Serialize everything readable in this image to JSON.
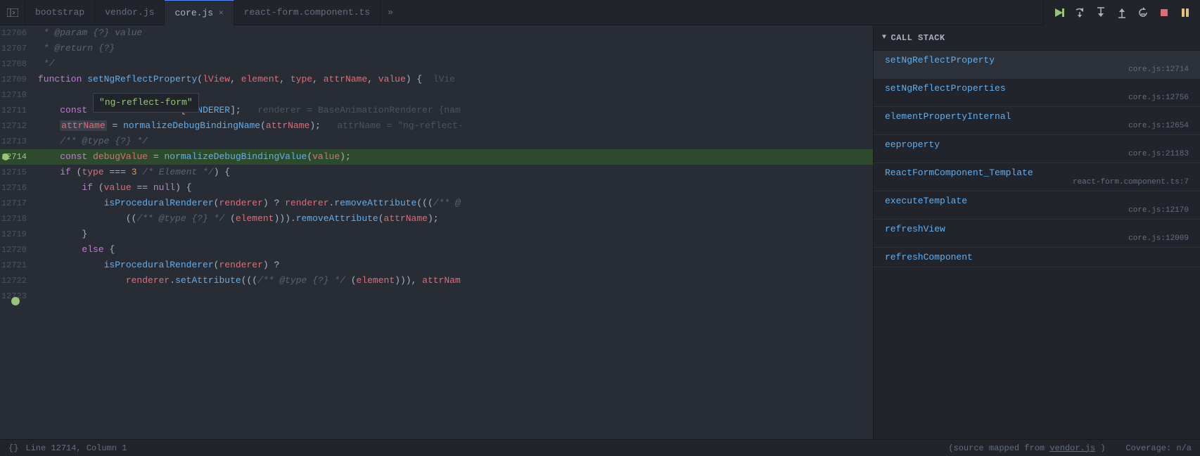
{
  "tabs": [
    {
      "id": "bootstrap",
      "label": "bootstrap",
      "active": false,
      "closable": false
    },
    {
      "id": "vendor",
      "label": "vendor.js",
      "active": false,
      "closable": false
    },
    {
      "id": "core",
      "label": "core.js",
      "active": true,
      "closable": true
    },
    {
      "id": "react-form",
      "label": "react-form.component.ts",
      "active": false,
      "closable": false
    }
  ],
  "tab_overflow_label": "»",
  "debug_buttons": [
    {
      "id": "continue",
      "icon": "▶",
      "class": "green",
      "label": "Continue"
    },
    {
      "id": "step-over",
      "icon": "↷",
      "class": "",
      "label": "Step Over"
    },
    {
      "id": "step-into",
      "icon": "↓",
      "class": "",
      "label": "Step Into"
    },
    {
      "id": "step-out",
      "icon": "↑",
      "class": "",
      "label": "Step Out"
    },
    {
      "id": "restart",
      "icon": "⟳",
      "class": "",
      "label": "Restart"
    },
    {
      "id": "stop",
      "icon": "⏹",
      "class": "",
      "label": "Stop"
    },
    {
      "id": "pause",
      "icon": "⏸",
      "class": "pause",
      "label": "Pause"
    }
  ],
  "code_lines": [
    {
      "num": "12706",
      "content": " * @param {?} value",
      "type": "comment"
    },
    {
      "num": "12707",
      "content": " * @return {?}",
      "type": "comment"
    },
    {
      "num": "12708",
      "content": " */",
      "type": "comment"
    },
    {
      "num": "12709",
      "content": "function setNgReflectProperty(lView, element, type, attrName, value) {",
      "type": "function_decl",
      "hint": " lVie"
    },
    {
      "num": "12710",
      "content": "    \"ng-reflect-form\"",
      "type": "tooltip_line"
    },
    {
      "num": "12711",
      "content": "    const renderer = lView[RENDERER];",
      "type": "code",
      "hint": " renderer = BaseAnimationRenderer {nam"
    },
    {
      "num": "12712",
      "content": "    attrName = normalizeDebugBindingName(attrName);",
      "type": "code",
      "hint": " attrName = \"ng-reflect-"
    },
    {
      "num": "12713",
      "content": "    /** @type {?} */",
      "type": "comment"
    },
    {
      "num": "12714",
      "content": "    const debugValue = normalizeDebugBindingValue(value);",
      "type": "active"
    },
    {
      "num": "12715",
      "content": "    if (type === 3 /* Element */) {",
      "type": "code"
    },
    {
      "num": "12716",
      "content": "        if (value == null) {",
      "type": "code"
    },
    {
      "num": "12717",
      "content": "            isProceduralRenderer(renderer) ? renderer.removeAttribute(((/** @",
      "type": "code"
    },
    {
      "num": "12718",
      "content": "                ((/** @type {?} */ (element))).removeAttribute(attrName);",
      "type": "code"
    },
    {
      "num": "12719",
      "content": "        }",
      "type": "code"
    },
    {
      "num": "12720",
      "content": "        else {",
      "type": "code"
    },
    {
      "num": "12721",
      "content": "            isProceduralRenderer(renderer) ?",
      "type": "code"
    },
    {
      "num": "12722",
      "content": "                renderer.setAttribute(((/** @type {?} */ (element))), attrNam",
      "type": "code"
    },
    {
      "num": "12723",
      "content": "",
      "type": "code"
    }
  ],
  "tooltip": "\"ng-reflect-form\"",
  "call_stack": {
    "title": "Call Stack",
    "items": [
      {
        "func": "setNgReflectProperty",
        "file": "core.js:12714",
        "active": true
      },
      {
        "func": "setNgReflectProperties",
        "file": "core.js:12756",
        "active": false
      },
      {
        "func": "elementPropertyInternal",
        "file": "core.js:12654",
        "active": false
      },
      {
        "func": "eeproperty",
        "file": "core.js:21183",
        "active": false
      },
      {
        "func": "ReactFormComponent_Template",
        "file": "react-form.component.ts:7",
        "active": false
      },
      {
        "func": "executeTemplate",
        "file": "core.js:12170",
        "active": false
      },
      {
        "func": "refreshView",
        "file": "core.js:12009",
        "active": false
      },
      {
        "func": "refreshComponent",
        "file": "",
        "active": false
      }
    ]
  },
  "status": {
    "left_icon": "{}",
    "position": "Line 12714, Column 1",
    "source_mapped": "(source mapped from",
    "vendor_link": "vendor.js",
    "source_mapped_end": ")",
    "coverage": "Coverage: n/a"
  }
}
